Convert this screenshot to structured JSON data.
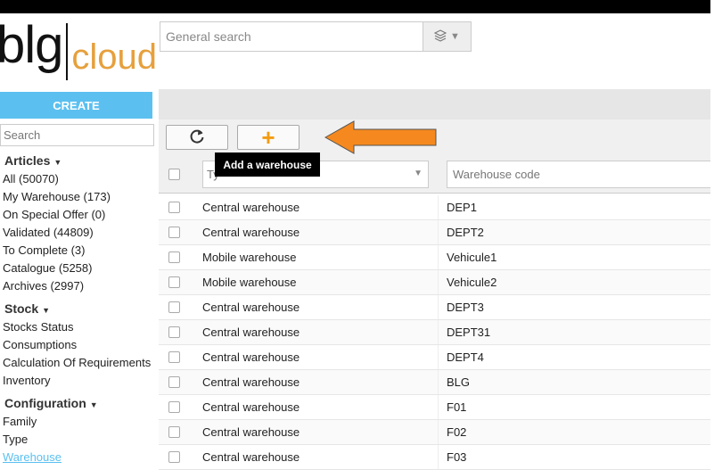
{
  "logo": {
    "part1": "blg",
    "part2": "cloud"
  },
  "global_search": {
    "placeholder": "General search"
  },
  "create_label": "CREATE",
  "sidebar_search": {
    "placeholder": "Search"
  },
  "sidebar": {
    "articles": {
      "title": "Articles",
      "items": [
        "All (50070)",
        "My Warehouse (173)",
        "On Special Offer (0)",
        "Validated (44809)",
        "To Complete (3)",
        "Catalogue (5258)",
        "Archives (2997)"
      ]
    },
    "stock": {
      "title": "Stock",
      "items": [
        "Stocks Status",
        "Consumptions",
        "Calculation Of Requirements",
        "Inventory"
      ]
    },
    "configuration": {
      "title": "Configuration",
      "items": [
        "Family",
        "Type",
        "Warehouse"
      ]
    }
  },
  "tooltip": "Add a warehouse",
  "filters": {
    "type_placeholder": "Ty",
    "code_placeholder": "Warehouse code"
  },
  "rows": [
    {
      "type": "Central warehouse",
      "code": "DEP1"
    },
    {
      "type": "Central warehouse",
      "code": "DEPT2"
    },
    {
      "type": "Mobile warehouse",
      "code": "Vehicule1"
    },
    {
      "type": "Mobile warehouse",
      "code": "Vehicule2"
    },
    {
      "type": "Central warehouse",
      "code": "DEPT3"
    },
    {
      "type": "Central warehouse",
      "code": "DEPT31"
    },
    {
      "type": "Central warehouse",
      "code": "DEPT4"
    },
    {
      "type": "Central warehouse",
      "code": "BLG"
    },
    {
      "type": "Central warehouse",
      "code": "F01"
    },
    {
      "type": "Central warehouse",
      "code": "F02"
    },
    {
      "type": "Central warehouse",
      "code": "F03"
    }
  ],
  "colors": {
    "accent": "#5bc0f0",
    "brand_orange": "#e6a03c",
    "add_icon": "#f39c12",
    "arrow": "#f5891f"
  },
  "icons": {
    "refresh": "refresh-icon",
    "add": "plus-icon",
    "search_mode": "layers-icon",
    "dropdown": "chevron-down-icon"
  }
}
